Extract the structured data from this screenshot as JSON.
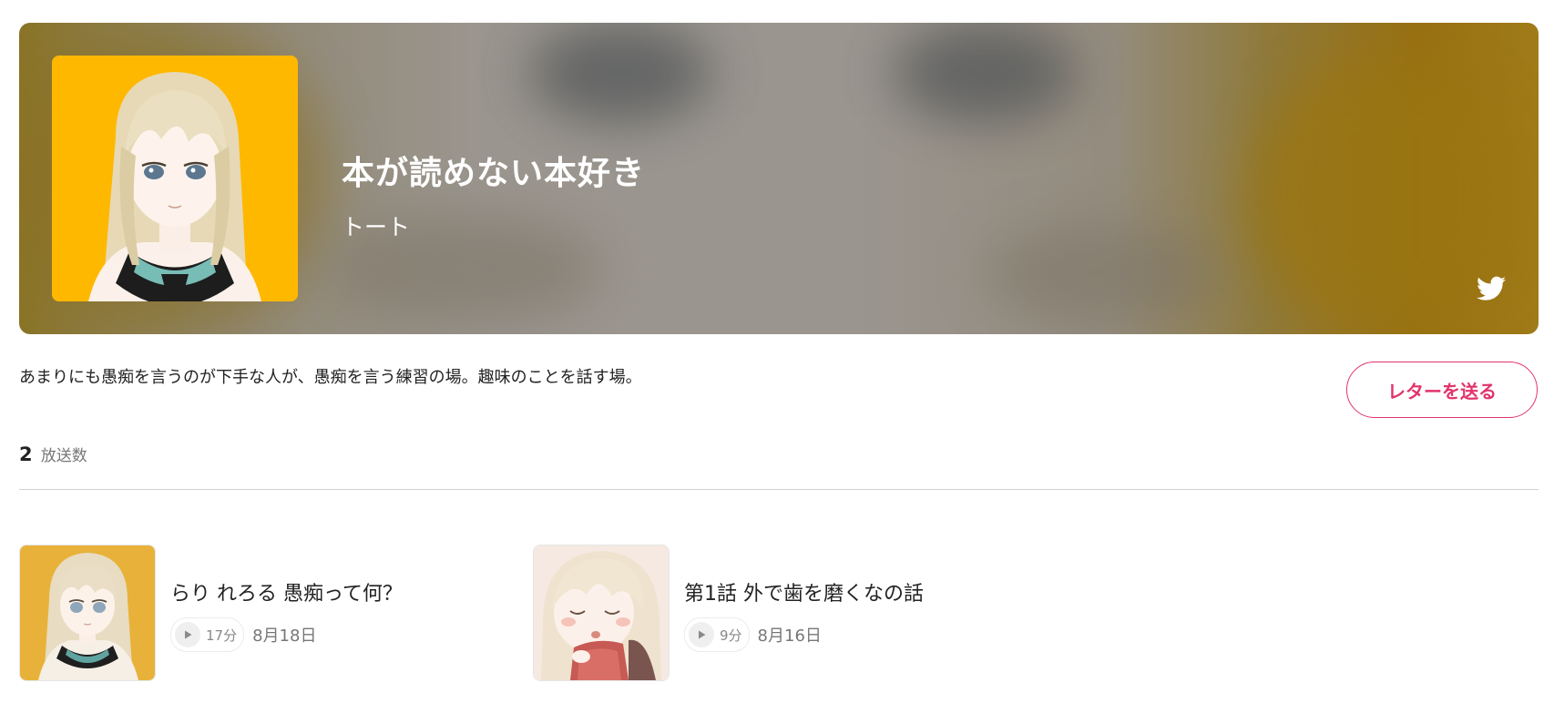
{
  "header": {
    "title": "本が読めない本好き",
    "author": "トート",
    "cover_bg_color": "#ffb800",
    "cover_image": "anime-girl-illustration",
    "share_icon": "twitter-icon"
  },
  "description": "あまりにも愚痴を言うのが下手な人が、愚痴を言う練習の場。趣味のことを話す場。",
  "letter_button": {
    "label": "レターを送る",
    "color": "#e2336b"
  },
  "stats": {
    "count": "2",
    "label": "放送数"
  },
  "episodes": [
    {
      "title": "らり れろる 愚痴って何？",
      "duration": "17分",
      "date": "8月18日",
      "thumbnail": "anime-girl-blonde",
      "thumbnail_bg": "#e8b23a"
    },
    {
      "title": "第1話 外で歯を磨くなの話",
      "duration": "9分",
      "date": "8月16日",
      "thumbnail": "anime-girl-reading-book",
      "thumbnail_bg": "#f5e9e2"
    }
  ],
  "icons": {
    "play": "play-icon"
  }
}
